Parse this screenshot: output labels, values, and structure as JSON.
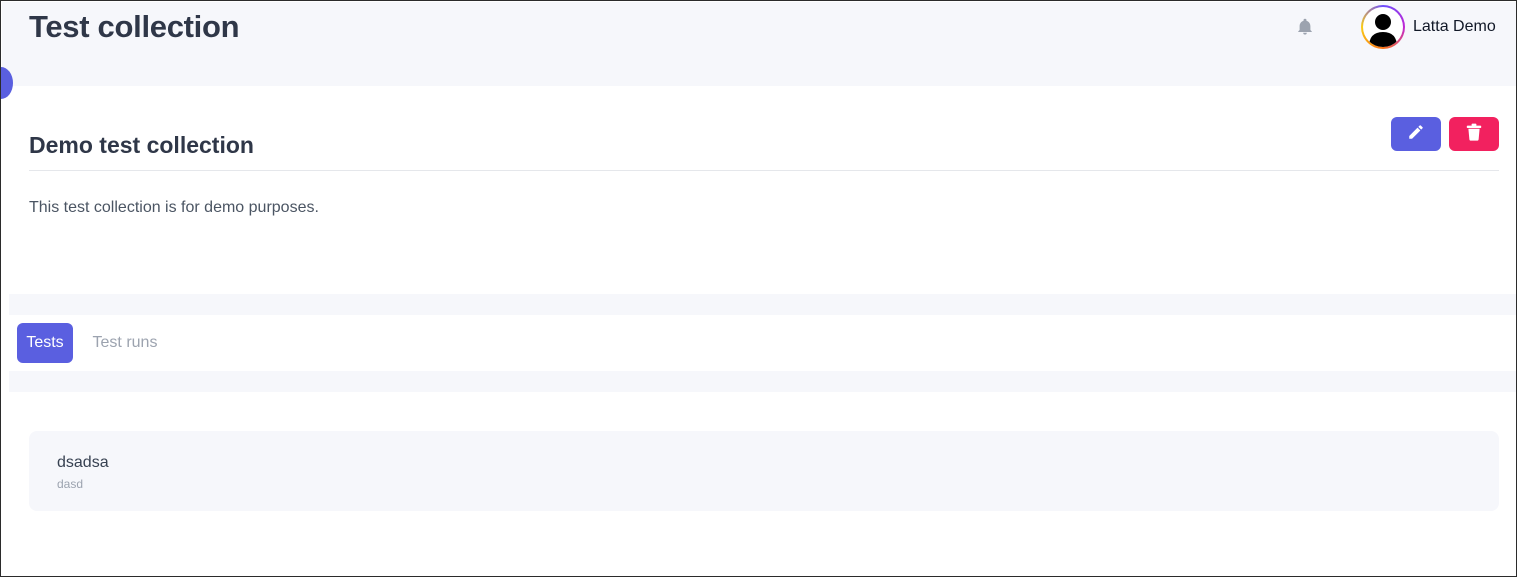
{
  "header": {
    "title": "Test collection",
    "user_name": "Latta Demo",
    "notification_icon": "bell-icon",
    "avatar_icon": "user-avatar-icon"
  },
  "collection": {
    "name": "Demo test collection",
    "description": "This test collection is for demo purposes.",
    "edit_icon": "pencil-icon",
    "delete_icon": "trash-icon"
  },
  "tabs": [
    {
      "label": "Tests",
      "active": true
    },
    {
      "label": "Test runs",
      "active": false
    }
  ],
  "tests": [
    {
      "name": "dsadsa",
      "description": "dasd"
    }
  ],
  "colors": {
    "accent": "#5a5fe0",
    "danger": "#f2215f",
    "header_bg": "#f6f7fb",
    "title_text": "#2f3748"
  }
}
